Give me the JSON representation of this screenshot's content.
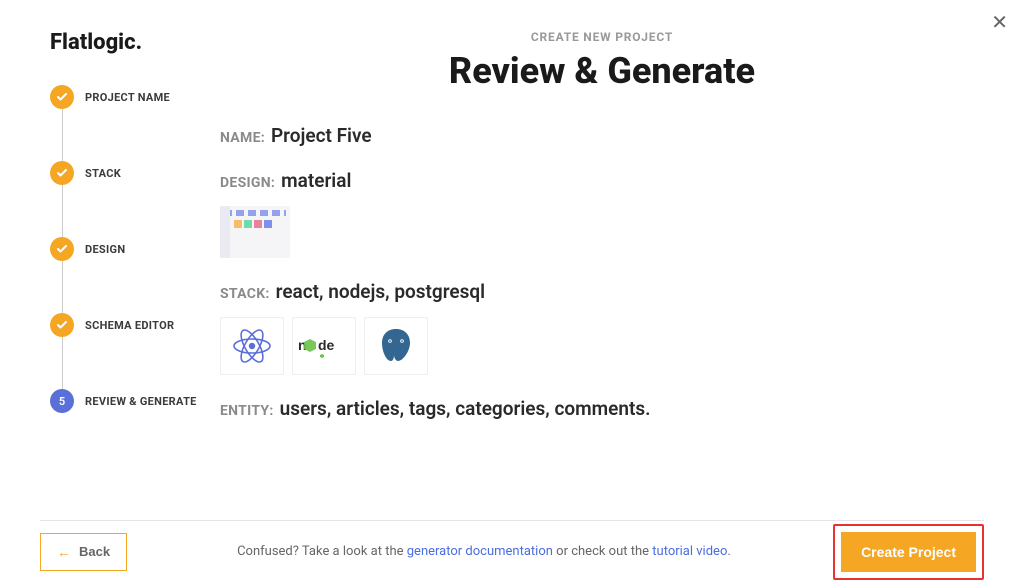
{
  "brand": "Flatlogic.",
  "overline": "CREATE NEW PROJECT",
  "title": "Review & Generate",
  "steps": [
    {
      "label": "PROJECT NAME",
      "state": "completed"
    },
    {
      "label": "STACK",
      "state": "completed"
    },
    {
      "label": "DESIGN",
      "state": "completed"
    },
    {
      "label": "SCHEMA EDITOR",
      "state": "completed"
    },
    {
      "label": "REVIEW & GENERATE",
      "state": "current",
      "number": "5"
    }
  ],
  "review": {
    "name_label": "NAME:",
    "name_value": "Project Five",
    "design_label": "DESIGN:",
    "design_value": "material",
    "stack_label": "STACK:",
    "stack_value": "react, nodejs, postgresql",
    "stack_icons": [
      "react",
      "nodejs",
      "postgresql"
    ],
    "entity_label": "ENTITY:",
    "entity_value": "users, articles, tags, categories, comments."
  },
  "footer": {
    "back_label": "Back",
    "help_prefix": "Confused? Take a look at the ",
    "help_link1": "generator documentation",
    "help_mid": " or check out the ",
    "help_link2": "tutorial video",
    "help_suffix": ".",
    "create_label": "Create Project"
  }
}
